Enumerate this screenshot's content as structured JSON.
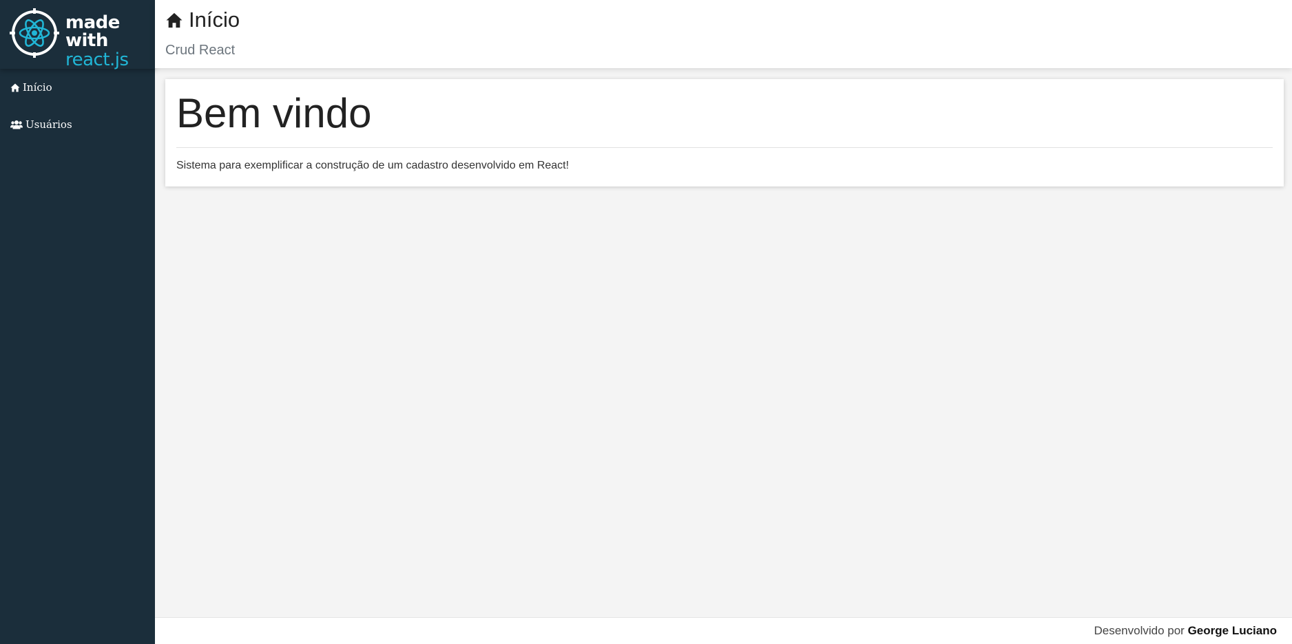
{
  "brand": {
    "logo_line1": "made with",
    "logo_line2": "react.js",
    "accent_color": "#21b6d6",
    "sidebar_color": "#1b2e3b"
  },
  "sidebar": {
    "items": [
      {
        "label": "Início",
        "icon": "home-icon"
      },
      {
        "label": "Usuários",
        "icon": "users-icon"
      }
    ]
  },
  "header": {
    "icon": "home-icon",
    "title": "Início",
    "subtitle": "Crud React"
  },
  "main": {
    "heading": "Bem vindo",
    "description": "Sistema para exemplificar a construção de um cadastro desenvolvido em React!"
  },
  "footer": {
    "prefix": "Desenvolvido por",
    "author": "George Luciano"
  }
}
